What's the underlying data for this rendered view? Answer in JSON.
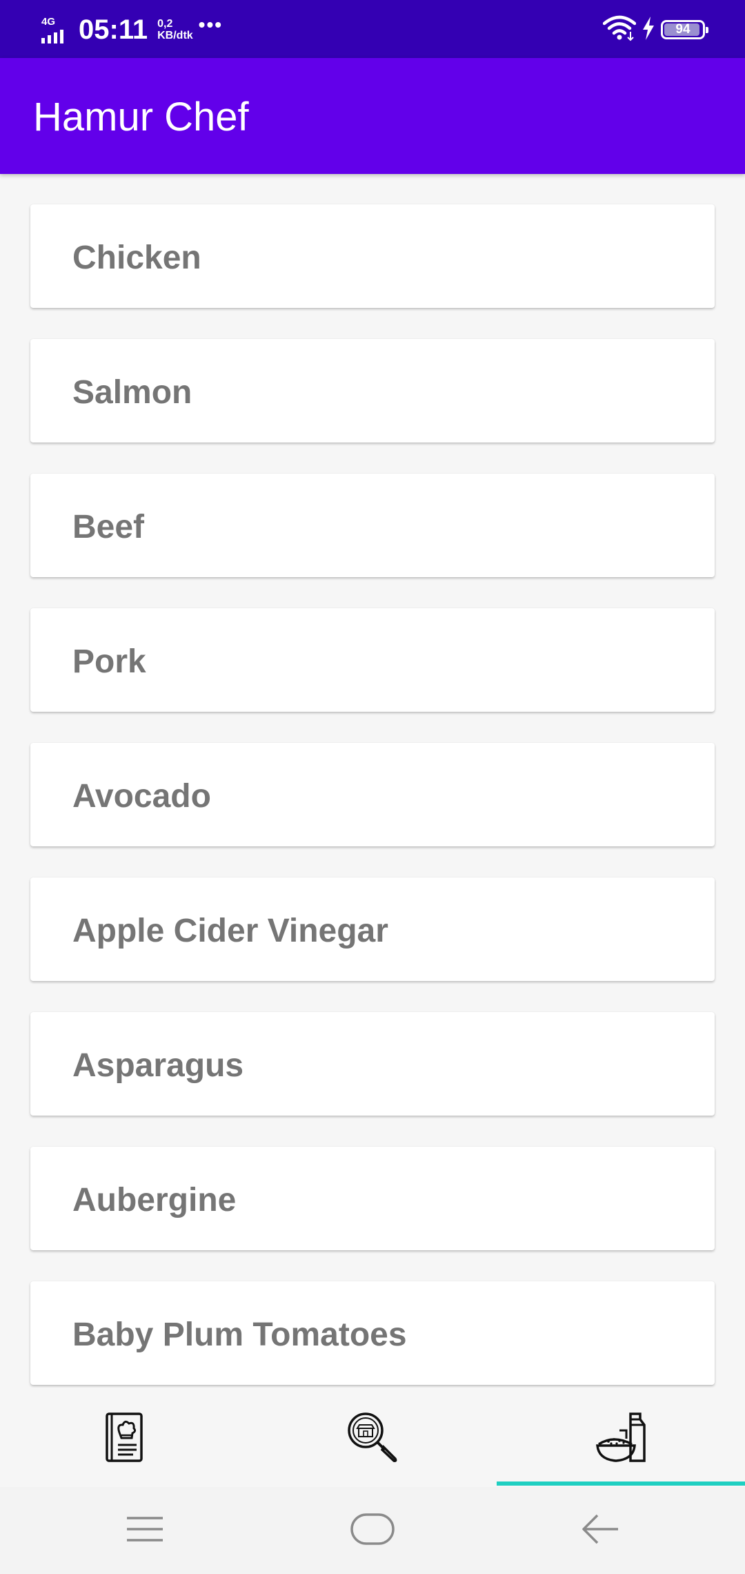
{
  "status_bar": {
    "network": "4G",
    "time": "05:11",
    "speed_value": "0,2",
    "speed_unit": "KB/dtk",
    "more": "•••",
    "battery_level": "94",
    "battery_fraction": 0.94,
    "icons": [
      "signal-icon",
      "wifi-icon",
      "charging-icon",
      "battery-icon"
    ]
  },
  "app_bar": {
    "title": "Hamur Chef"
  },
  "ingredients": [
    {
      "label": "Chicken"
    },
    {
      "label": "Salmon"
    },
    {
      "label": "Beef"
    },
    {
      "label": "Pork"
    },
    {
      "label": "Avocado"
    },
    {
      "label": "Apple Cider Vinegar"
    },
    {
      "label": "Asparagus"
    },
    {
      "label": "Aubergine"
    },
    {
      "label": "Baby Plum Tomatoes"
    }
  ],
  "bottom_nav": {
    "items": [
      {
        "icon": "recipe-book-icon",
        "selected": false
      },
      {
        "icon": "search-restaurant-icon",
        "selected": false
      },
      {
        "icon": "ingredients-icon",
        "selected": true
      }
    ],
    "accent_color": "#1fcfc1"
  },
  "system_nav": {
    "icons": [
      "menu-icon",
      "home-icon",
      "back-icon"
    ]
  },
  "colors": {
    "status_bar": "#3400b3",
    "app_bar": "#6200ea",
    "card_text": "#757575",
    "background": "#f6f6f6"
  }
}
